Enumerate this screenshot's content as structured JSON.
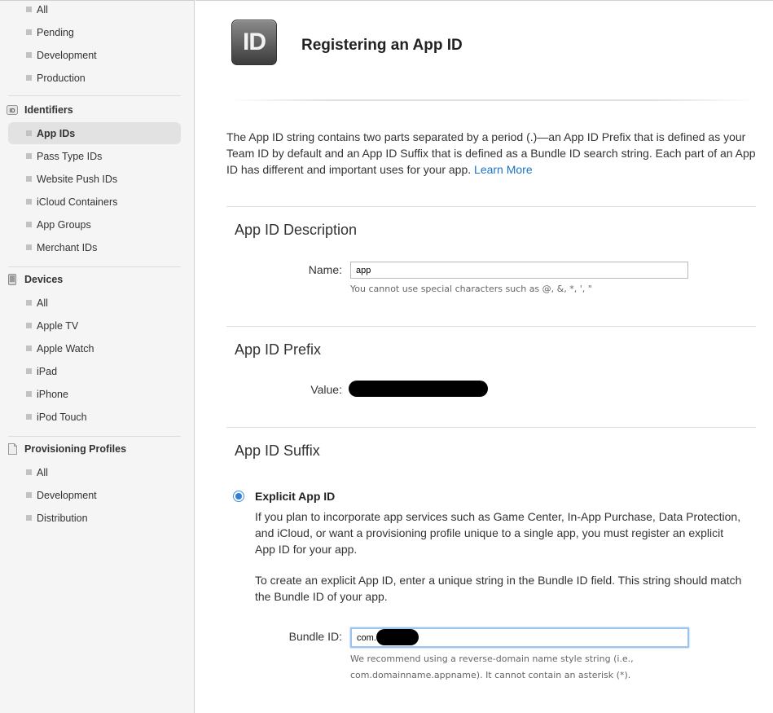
{
  "sidebar": {
    "top_items": [
      "All",
      "Pending",
      "Development",
      "Production"
    ],
    "identifiers": {
      "title": "Identifiers",
      "items": [
        "App IDs",
        "Pass Type IDs",
        "Website Push IDs",
        "iCloud Containers",
        "App Groups",
        "Merchant IDs"
      ],
      "selected": "App IDs"
    },
    "devices": {
      "title": "Devices",
      "items": [
        "All",
        "Apple TV",
        "Apple Watch",
        "iPad",
        "iPhone",
        "iPod Touch"
      ]
    },
    "profiles": {
      "title": "Provisioning Profiles",
      "items": [
        "All",
        "Development",
        "Distribution"
      ]
    }
  },
  "page": {
    "icon_text": "ID",
    "title": "Registering an App ID",
    "intro": "The App ID string contains two parts separated by a period (.)—an App ID Prefix that is defined as your Team ID by default and an App ID Suffix that is defined as a Bundle ID search string. Each part of an App ID has different and important uses for your app.",
    "learn_more": "Learn More"
  },
  "description": {
    "title": "App ID Description",
    "name_label": "Name:",
    "name_value": "app",
    "name_hint": "You cannot use special characters such as @, &, *, ', \""
  },
  "prefix": {
    "title": "App ID Prefix",
    "value_label": "Value:"
  },
  "suffix": {
    "title": "App ID Suffix",
    "option_label": "Explicit App ID",
    "para1": "If you plan to incorporate app services such as Game Center, In-App Purchase, Data Protection, and iCloud, or want a provisioning profile unique to a single app, you must register an explicit App ID for your app.",
    "para2": "To create an explicit App ID, enter a unique string in the Bundle ID field. This string should match the Bundle ID of your app.",
    "bundle_label": "Bundle ID:",
    "bundle_value": "com.        .app",
    "bundle_hint": "We recommend using a reverse-domain name style string (i.e., com.domainname.appname). It cannot contain an asterisk (*)."
  },
  "colors": {
    "accent": "#2d7fd8",
    "link": "#1a73c7",
    "sidebar_bg": "#f5f5f5"
  }
}
